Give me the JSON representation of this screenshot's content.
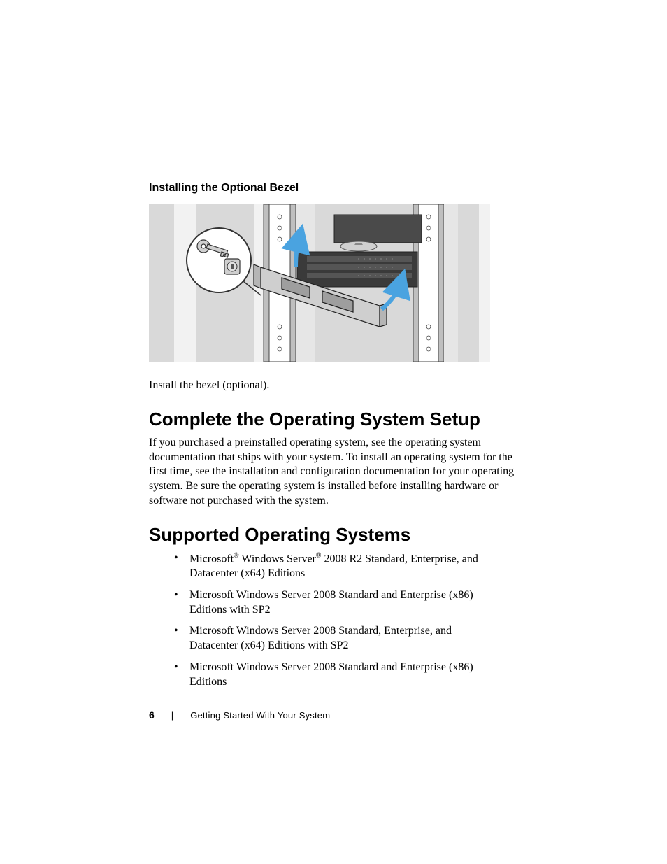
{
  "section_subhead": "Installing the Optional Bezel",
  "figure_caption": "Install the bezel (optional).",
  "h1_a": "Complete the Operating System Setup",
  "para_a": "If you purchased a preinstalled operating system, see the operating system documentation that ships with your system. To install an operating system for the first time, see the installation and configuration documentation for your operating system. Be sure the operating system is installed before installing hardware or software not purchased with the system.",
  "h1_b": "Supported Operating Systems",
  "os_items": [
    {
      "pre": "Microsoft",
      "reg1": "®",
      "mid": " Windows Server",
      "reg2": "®",
      "post": " 2008 R2 Standard, Enterprise, and Datacenter (x64) Editions"
    },
    {
      "text": "Microsoft Windows Server 2008 Standard and Enterprise (x86) Editions with SP2"
    },
    {
      "text": "Microsoft Windows Server 2008 Standard, Enterprise, and Datacenter (x64) Editions with SP2"
    },
    {
      "text": "Microsoft Windows Server 2008 Standard and Enterprise (x86) Editions"
    }
  ],
  "footer": {
    "page_number": "6",
    "separator": "|",
    "title": "Getting Started With Your System"
  }
}
